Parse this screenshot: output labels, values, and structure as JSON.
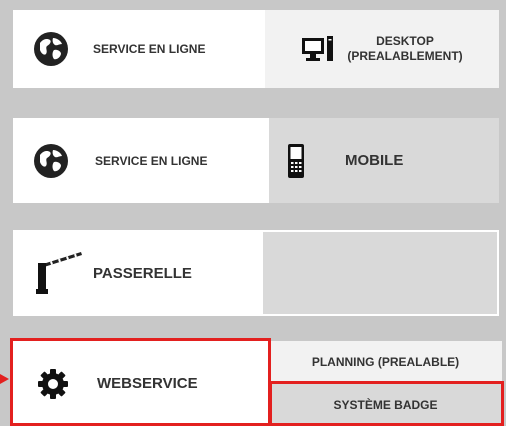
{
  "rows": [
    {
      "left_label": "SERVICE EN LIGNE",
      "left_icon": "globe-icon",
      "right_icon": "desktop-computer-icon",
      "right_label_line1": "DESKTOP",
      "right_label_line2": "(PREALABLEMENT)"
    },
    {
      "left_label": "SERVICE EN LIGNE",
      "left_icon": "globe-icon",
      "right_icon": "mobile-phone-icon",
      "right_label": "MOBILE"
    },
    {
      "left_label": "PASSERELLE",
      "left_icon": "barrier-gate-icon",
      "right_label": ""
    },
    {
      "left_label": "WEBSERVICE",
      "left_icon": "gear-icon",
      "right_top_label": "PLANNING (PREALABLE)",
      "right_bottom_label": "SYSTÈME BADGE"
    }
  ],
  "colors": {
    "background": "#c8c8c8",
    "panel": "#ffffff",
    "panel_grey": "#d9d9d9",
    "highlight": "#e3201f",
    "text": "#333333"
  }
}
